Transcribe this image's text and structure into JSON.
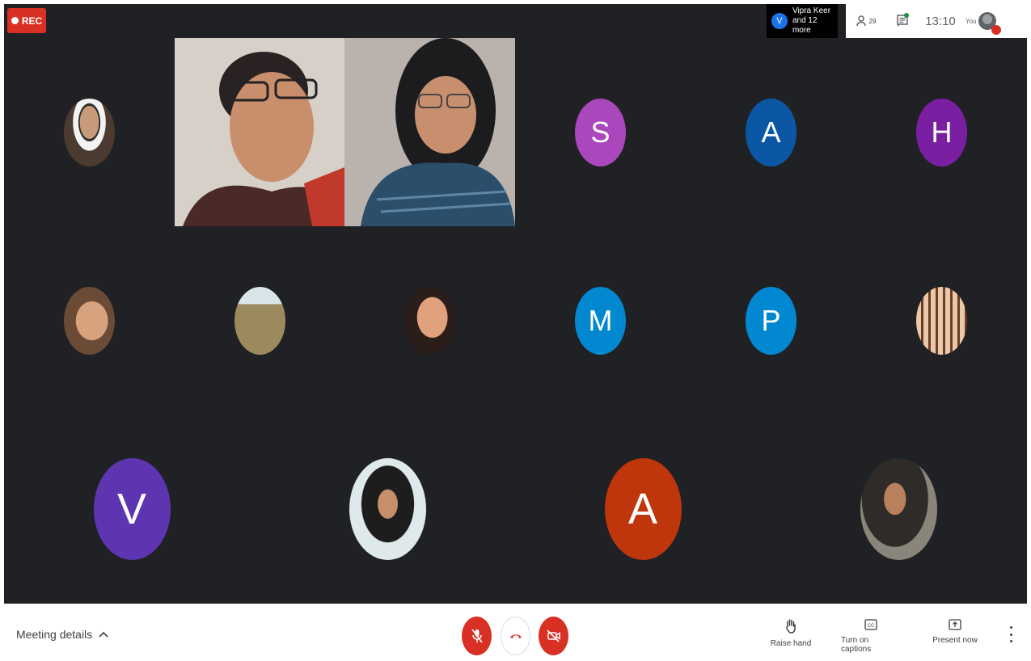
{
  "rec": {
    "label": "REC"
  },
  "speaker_chip": {
    "initial": "V",
    "line1": "Vipra Keer",
    "line2": "and 12 more"
  },
  "top_right": {
    "people_count": "29",
    "time": "13:10",
    "you_label": "You"
  },
  "participants": {
    "row1": [
      {
        "type": "photo",
        "name": "participant-1"
      },
      {
        "type": "video",
        "name": "video-participant-1"
      },
      {
        "type": "video",
        "name": "video-participant-2"
      },
      {
        "type": "initial",
        "initial": "S",
        "color": "#ab47bc"
      },
      {
        "type": "initial",
        "initial": "A",
        "color": "#0b57a6"
      },
      {
        "type": "initial",
        "initial": "H",
        "color": "#7b1fa2"
      }
    ],
    "row2": [
      {
        "type": "photo"
      },
      {
        "type": "photo"
      },
      {
        "type": "photo"
      },
      {
        "type": "initial",
        "initial": "M",
        "color": "#0288d1"
      },
      {
        "type": "initial",
        "initial": "P",
        "color": "#0288d1"
      },
      {
        "type": "photo"
      }
    ],
    "row3": [
      {
        "type": "initial",
        "initial": "V",
        "color": "#5e35b1"
      },
      {
        "type": "photo"
      },
      {
        "type": "initial",
        "initial": "A",
        "color": "#bf360c"
      },
      {
        "type": "photo"
      }
    ]
  },
  "bottom": {
    "meeting_details": "Meeting details",
    "raise_hand": "Raise hand",
    "captions": "Turn on captions",
    "present": "Present now"
  },
  "colors": {
    "grid_bg": "#202124",
    "red": "#d93025"
  }
}
